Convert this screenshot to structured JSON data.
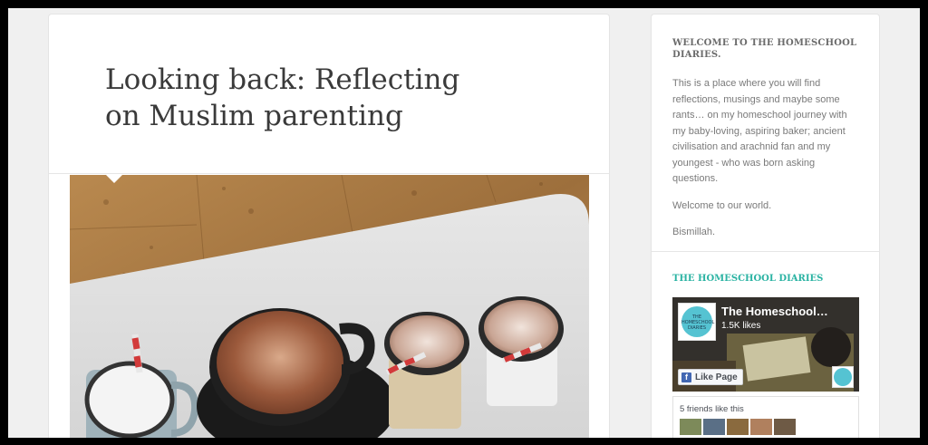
{
  "post": {
    "title": "Looking back: Reflecting on Muslim parenting"
  },
  "sidebar": {
    "welcome": {
      "title": "WELCOME TO THE HOMESCHOOL DIARIES.",
      "paragraphs": [
        "This is a place where you will find reflections, musings and maybe some rants… on my homeschool journey with my baby-loving, aspiring baker; ancient civilisation and arachnid fan and my youngest - who was born asking questions.",
        "Welcome to our world.",
        "Bismillah."
      ]
    },
    "facebook_widget": {
      "title": "THE HOMESCHOOL DIARIES",
      "page_name": "The Homeschool…",
      "likes": "1.5K likes",
      "like_button": "Like Page",
      "logo_text": "THE HOMESCHOOL DIARIES",
      "friends_text": "5 friends like this"
    }
  },
  "colors": {
    "accent": "#2bb3a3",
    "facebook_blue": "#4267b2"
  }
}
